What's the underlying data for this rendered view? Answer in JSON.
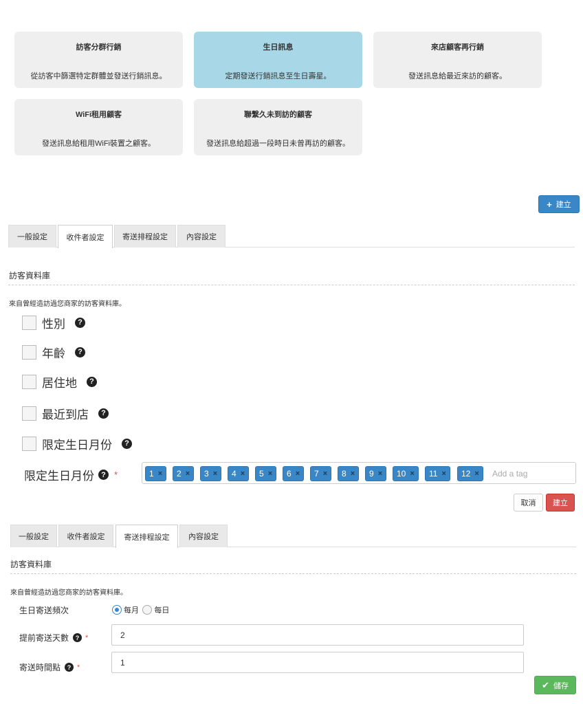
{
  "cards": [
    {
      "title": "訪客分群行銷",
      "desc": "從訪客中篩選特定群體並發送行銷訊息。"
    },
    {
      "title": "生日訊息",
      "desc": "定期發送行銷訊息至生日壽星。"
    },
    {
      "title": "來店顧客再行銷",
      "desc": "發送訊息給最近來訪的顧客。"
    },
    {
      "title": "WiFi租用顧客",
      "desc": "發送訊息給租用WiFi裝置之顧客。"
    },
    {
      "title": "聯繫久未到訪的顧客",
      "desc": "發送訊息給超過一段時日未曾再訪的顧客。"
    }
  ],
  "create_top_label": "建立",
  "tabs": [
    "一般設定",
    "收件者設定",
    "寄送排程設定",
    "內容設定"
  ],
  "section_title": "訪客資料庫",
  "section_desc": "來自曾經造訪過您商家的訪客資料庫。",
  "filters": [
    "性別",
    "年齡",
    "居住地",
    "最近到店",
    "限定生日月份"
  ],
  "birth_month": {
    "label": "限定生日月份",
    "required_mark": "*",
    "tags": [
      "1",
      "2",
      "3",
      "4",
      "5",
      "6",
      "7",
      "8",
      "9",
      "10",
      "11",
      "12"
    ],
    "remove_glyph": "×",
    "placeholder": "Add a tag"
  },
  "buttons": {
    "cancel": "取消",
    "create": "建立",
    "save": "儲存"
  },
  "schedule": {
    "freq_label": "生日寄送頻次",
    "freq_options": [
      "每月",
      "每日"
    ],
    "freq_selected": "每月",
    "advance_days_label": "提前寄送天數",
    "advance_days_value": "2",
    "send_time_label": "寄送時間點",
    "send_time_value": "1",
    "required_mark": "*"
  },
  "icons": {
    "help": "question-circle-icon",
    "add": "plus-icon",
    "check": "check-icon"
  },
  "colors": {
    "primary": "#3a87c8",
    "danger": "#d9534f",
    "success": "#5cb85c",
    "selected_card": "#a8d8e8",
    "card": "#efefef"
  }
}
